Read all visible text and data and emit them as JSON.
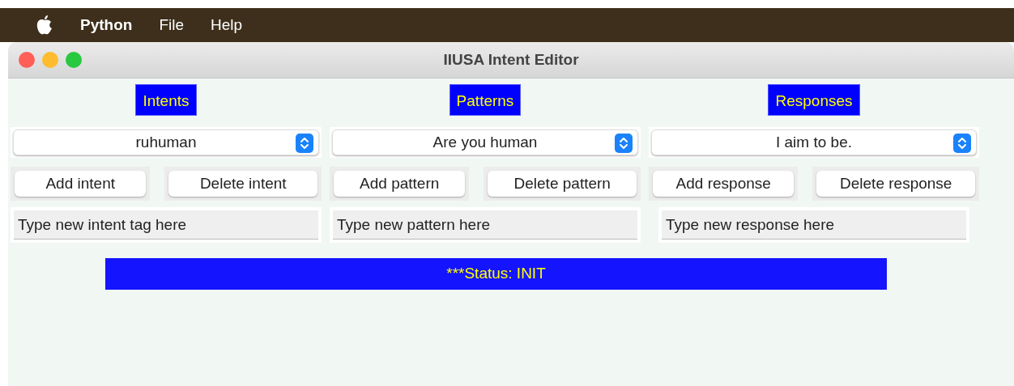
{
  "menu_bar": {
    "items": [
      {
        "label": "Python",
        "bold": true
      },
      {
        "label": "File",
        "bold": false
      },
      {
        "label": "Help",
        "bold": false
      }
    ]
  },
  "window": {
    "title": "IIUSA Intent Editor"
  },
  "columns": [
    {
      "heading": "Intents",
      "select": {
        "value": "ruhuman"
      },
      "buttons": [
        "Add intent",
        "Delete intent"
      ],
      "field": {
        "value": "Type new intent tag here"
      }
    },
    {
      "heading": "Patterns",
      "select": {
        "value": "Are you human"
      },
      "buttons": [
        "Add pattern",
        "Delete pattern"
      ],
      "field": {
        "value": "Type new pattern here"
      }
    },
    {
      "heading": "Responses",
      "select": {
        "value": "I aim to be."
      },
      "buttons": [
        "Add response",
        "Delete response"
      ],
      "field": {
        "value": "Type new response here"
      }
    }
  ],
  "status": "***Status: INIT"
}
